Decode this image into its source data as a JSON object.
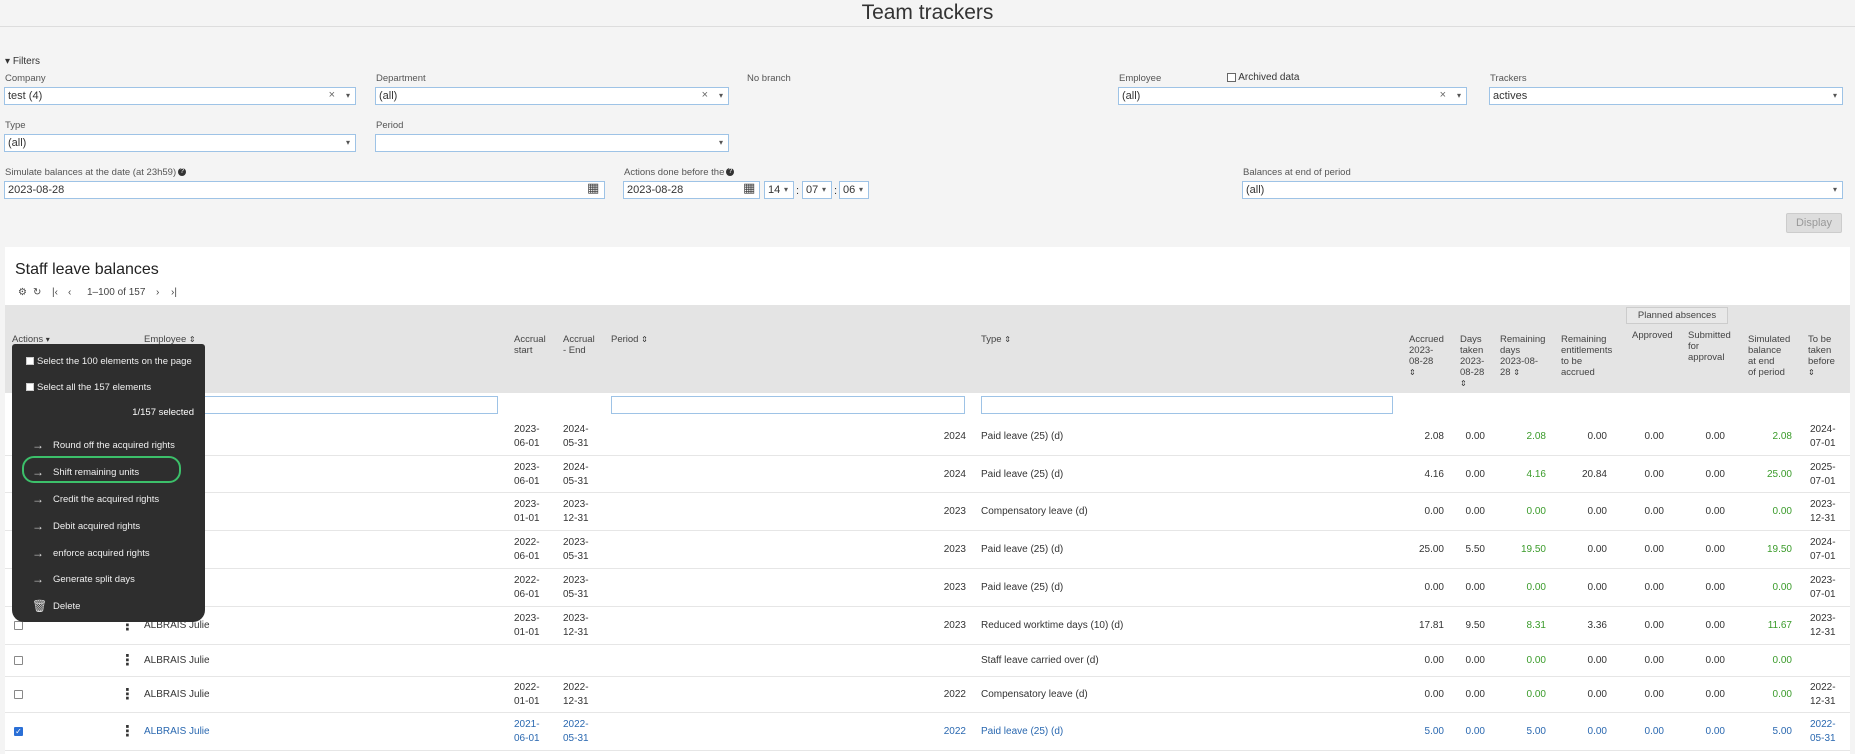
{
  "page_title": "Team trackers",
  "filters": {
    "toggle_label": "Filters",
    "company": {
      "label": "Company",
      "value": "test (4)"
    },
    "department": {
      "label": "Department",
      "value": "(all)"
    },
    "no_branch": "No branch",
    "employee": {
      "label": "Employee",
      "value": "(all)"
    },
    "archived_data": "Archived data",
    "trackers": {
      "label": "Trackers",
      "value": "actives"
    },
    "type": {
      "label": "Type",
      "value": "(all)"
    },
    "period": {
      "label": "Period",
      "value": ""
    },
    "simulate": {
      "label": "Simulate balances at the date (at 23h59)",
      "value": "2023-08-28"
    },
    "actions_before": {
      "label": "Actions done before the",
      "value": "2023-08-28",
      "hour": "14",
      "minute": "07",
      "second": "06"
    },
    "balances_end": {
      "label": "Balances at end of period",
      "value": "(all)"
    },
    "display_button": "Display"
  },
  "table": {
    "title": "Staff leave balances",
    "pager": "1–100 of 157",
    "headers": {
      "actions": "Actions",
      "employee": "Employee",
      "accrual_start": [
        "Accrual",
        "start"
      ],
      "accrual_end": [
        "Accrual",
        "- End"
      ],
      "period": "Period",
      "type": "Type",
      "accrued": [
        "Accrued",
        "2023-",
        "08-28"
      ],
      "days_taken": [
        "Days",
        "taken",
        "2023-",
        "08-28"
      ],
      "remaining_days": [
        "Remaining",
        "days",
        "2023-08-",
        "28"
      ],
      "remaining_entitlements": [
        "Remaining",
        "entitlements",
        "to be",
        "accrued"
      ],
      "planned_absences": "Planned absences",
      "approved": "Approved",
      "submitted": [
        "Submitted",
        "for",
        "approval"
      ],
      "simulated": [
        "Simulated",
        "balance",
        "at end",
        "of period"
      ],
      "to_be_taken": [
        "To be",
        "taken",
        "before"
      ]
    },
    "rows": [
      {
        "employee": "",
        "start": [
          "2023-",
          "06-01"
        ],
        "end": [
          "2024-",
          "05-31"
        ],
        "period": "2024",
        "type": "Paid leave (25) (d)",
        "accrued": "2.08",
        "taken": "0.00",
        "remaining": "2.08",
        "entitlements": "0.00",
        "approved": "0.00",
        "submitted": "0.00",
        "simulated": "2.08",
        "before": [
          "2024-",
          "07-01"
        ]
      },
      {
        "employee": "",
        "start": [
          "2023-",
          "06-01"
        ],
        "end": [
          "2024-",
          "05-31"
        ],
        "period": "2024",
        "type": "Paid leave (25) (d)",
        "accrued": "4.16",
        "taken": "0.00",
        "remaining": "4.16",
        "entitlements": "20.84",
        "approved": "0.00",
        "submitted": "0.00",
        "simulated": "25.00",
        "before": [
          "2025-",
          "07-01"
        ]
      },
      {
        "employee": "",
        "start": [
          "2023-",
          "01-01"
        ],
        "end": [
          "2023-",
          "12-31"
        ],
        "period": "2023",
        "type": "Compensatory leave (d)",
        "accrued": "0.00",
        "taken": "0.00",
        "remaining": "0.00",
        "entitlements": "0.00",
        "approved": "0.00",
        "submitted": "0.00",
        "simulated": "0.00",
        "before": [
          "2023-",
          "12-31"
        ]
      },
      {
        "employee": "",
        "start": [
          "2022-",
          "06-01"
        ],
        "end": [
          "2023-",
          "05-31"
        ],
        "period": "2023",
        "type": "Paid leave (25) (d)",
        "accrued": "25.00",
        "taken": "5.50",
        "remaining": "19.50",
        "entitlements": "0.00",
        "approved": "0.00",
        "submitted": "0.00",
        "simulated": "19.50",
        "before": [
          "2024-",
          "07-01"
        ]
      },
      {
        "employee": "",
        "start": [
          "2022-",
          "06-01"
        ],
        "end": [
          "2023-",
          "05-31"
        ],
        "period": "2023",
        "type": "Paid leave (25) (d)",
        "accrued": "0.00",
        "taken": "0.00",
        "remaining": "0.00",
        "entitlements": "0.00",
        "approved": "0.00",
        "submitted": "0.00",
        "simulated": "0.00",
        "before": [
          "2023-",
          "07-01"
        ]
      },
      {
        "employee": "ALBRAIS Julie",
        "start": [
          "2023-",
          "01-01"
        ],
        "end": [
          "2023-",
          "12-31"
        ],
        "period": "2023",
        "type": "Reduced worktime days (10) (d)",
        "accrued": "17.81",
        "taken": "9.50",
        "remaining": "8.31",
        "entitlements": "3.36",
        "approved": "0.00",
        "submitted": "0.00",
        "simulated": "11.67",
        "before": [
          "2023-",
          "12-31"
        ]
      },
      {
        "employee": "ALBRAIS Julie",
        "start": [
          "",
          ""
        ],
        "end": [
          "",
          ""
        ],
        "period": "",
        "type": "Staff leave carried over (d)",
        "accrued": "0.00",
        "taken": "0.00",
        "remaining": "0.00",
        "entitlements": "0.00",
        "approved": "0.00",
        "submitted": "0.00",
        "simulated": "0.00",
        "before": [
          "",
          ""
        ]
      },
      {
        "employee": "ALBRAIS Julie",
        "start": [
          "2022-",
          "01-01"
        ],
        "end": [
          "2022-",
          "12-31"
        ],
        "period": "2022",
        "type": "Compensatory leave (d)",
        "accrued": "0.00",
        "taken": "0.00",
        "remaining": "0.00",
        "entitlements": "0.00",
        "approved": "0.00",
        "submitted": "0.00",
        "simulated": "0.00",
        "before": [
          "2022-",
          "12-31"
        ]
      },
      {
        "employee": "ALBRAIS Julie",
        "start": [
          "2021-",
          "06-01"
        ],
        "end": [
          "2022-",
          "05-31"
        ],
        "period": "2022",
        "type": "Paid leave (25) (d)",
        "accrued": "5.00",
        "taken": "0.00",
        "remaining": "5.00",
        "entitlements": "0.00",
        "approved": "0.00",
        "submitted": "0.00",
        "simulated": "5.00",
        "before": [
          "2022-",
          "05-31"
        ]
      }
    ]
  },
  "actions_menu": {
    "select_page": "Select the 100 elements on the page",
    "select_all": "Select all the 157 elements",
    "selected_count": "1/157 selected",
    "items": [
      "Round off the acquired rights",
      "Shift remaining units",
      "Credit the acquired rights",
      "Debit acquired rights",
      "enforce acquired rights",
      "Generate split days"
    ],
    "delete": "Delete"
  },
  "colors": {
    "accent_green": "#3a9b2a",
    "selected_blue": "#2a68b0",
    "menu_bg": "#2e2e2e",
    "highlight_ring": "#3cc06a"
  }
}
